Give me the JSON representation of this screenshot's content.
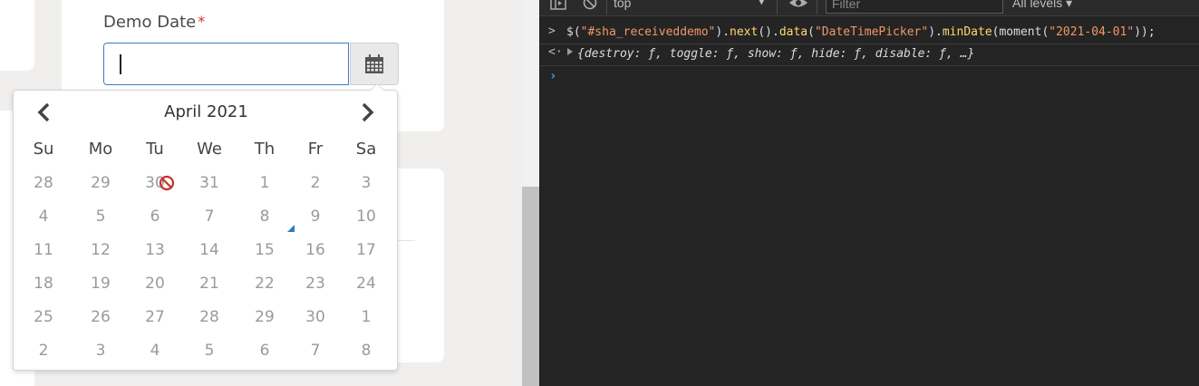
{
  "form": {
    "label": "Demo Date",
    "required_mark": "*",
    "input_value": ""
  },
  "datepicker": {
    "month_title": "April 2021",
    "weekdays": [
      "Su",
      "Mo",
      "Tu",
      "We",
      "Th",
      "Fr",
      "Sa"
    ],
    "weeks": [
      [
        "28",
        "29",
        "30",
        "31",
        "1",
        "2",
        "3"
      ],
      [
        "4",
        "5",
        "6",
        "7",
        "8",
        "9",
        "10"
      ],
      [
        "11",
        "12",
        "13",
        "14",
        "15",
        "16",
        "17"
      ],
      [
        "18",
        "19",
        "20",
        "21",
        "22",
        "23",
        "24"
      ],
      [
        "25",
        "26",
        "27",
        "28",
        "29",
        "30",
        "1"
      ],
      [
        "2",
        "3",
        "4",
        "5",
        "6",
        "7",
        "8"
      ]
    ],
    "today_marker": "8",
    "accent_color": "#337ab7",
    "disabled_icon_color": "#c9302c"
  },
  "devtools": {
    "context": "top",
    "filter_placeholder": "Filter",
    "levels": "All levels ▾",
    "input_prefix": ">",
    "code": {
      "p1": "$(",
      "s1": "\"#sha_receiveddemo\"",
      "p2": ").",
      "f1": "next",
      "p3": "().",
      "f2": "data",
      "p4": "(",
      "s2": "\"DateTimePicker\"",
      "p5": ").",
      "f3": "minDate",
      "p6": "(moment(",
      "s3": "\"2021-04-01\"",
      "p7": "));"
    },
    "result_prefix": "<·",
    "result_text": "{destroy: ƒ, toggle: ƒ, show: ƒ, hide: ƒ, disable: ƒ, …}",
    "prompt": "›"
  }
}
